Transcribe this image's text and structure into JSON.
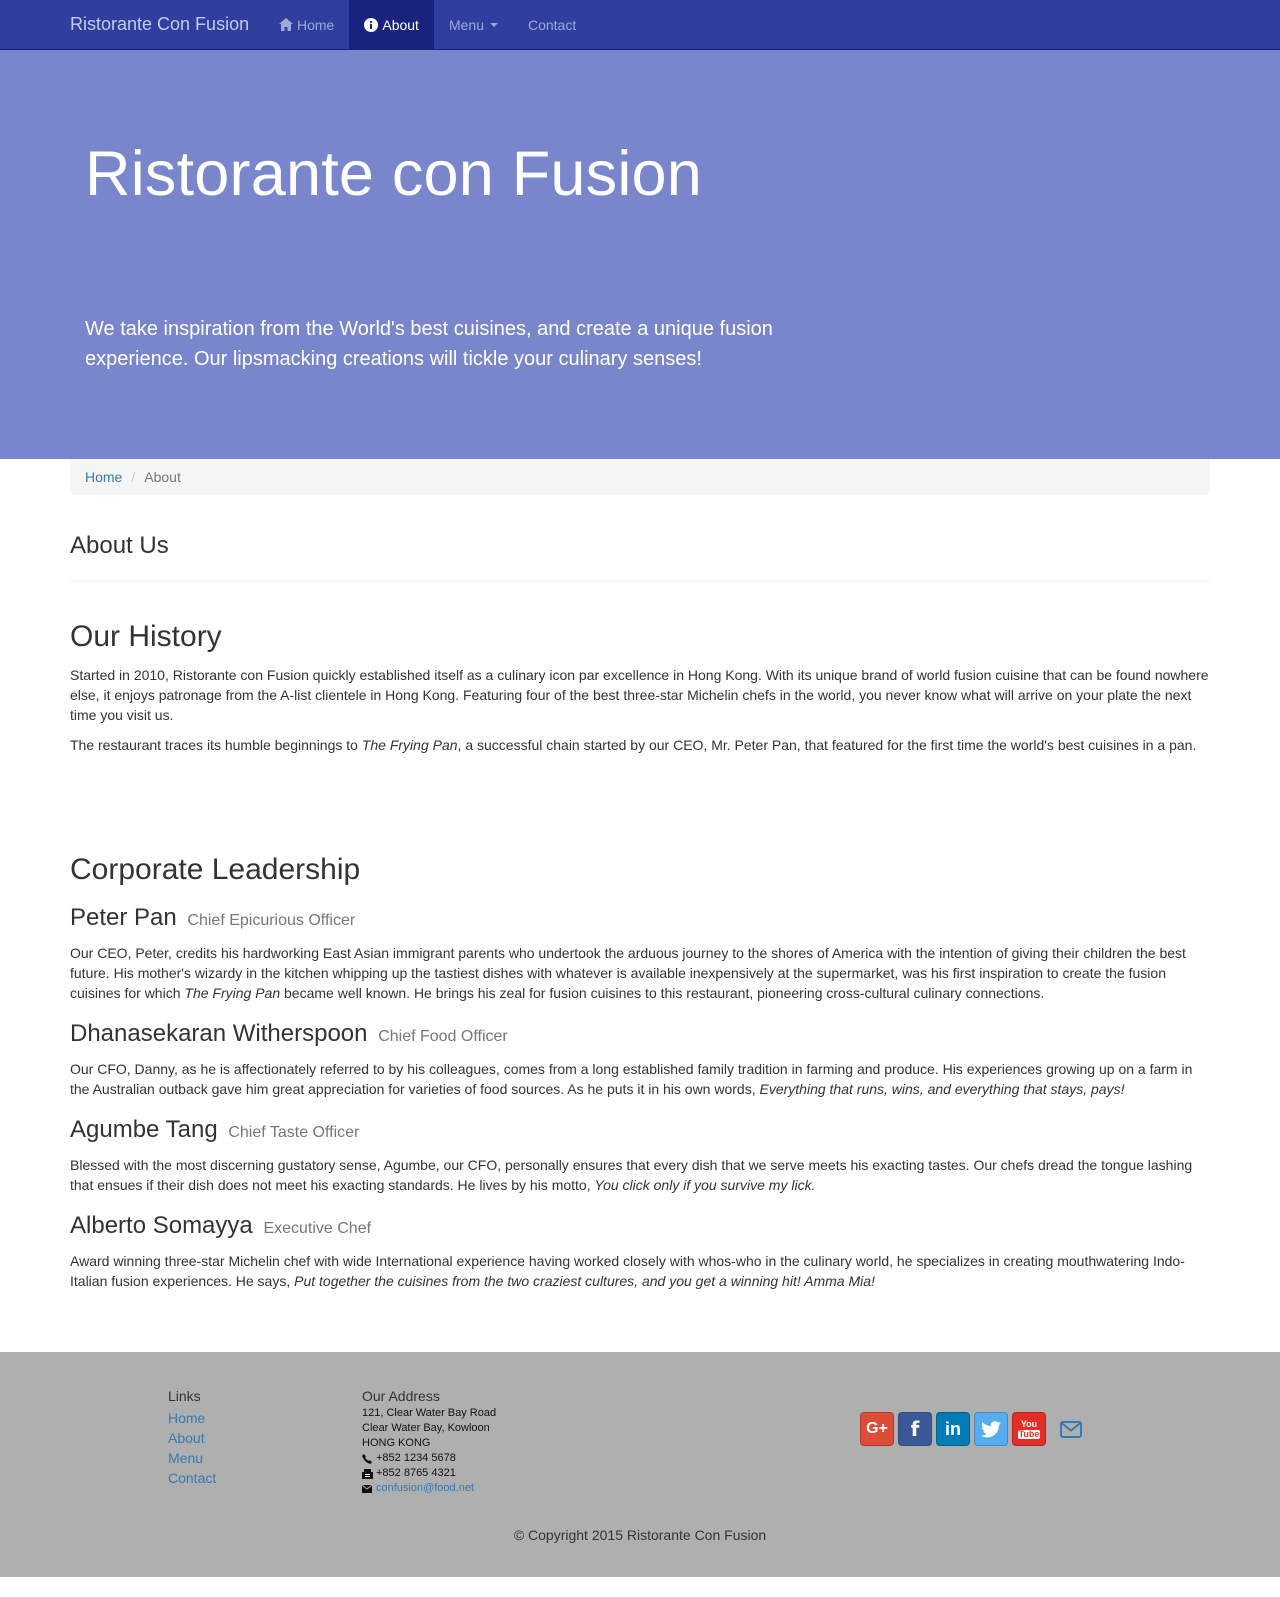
{
  "navbar": {
    "brand": "Ristorante Con Fusion",
    "items": [
      {
        "label": "Home"
      },
      {
        "label": "About"
      },
      {
        "label": "Menu"
      },
      {
        "label": "Contact"
      }
    ]
  },
  "jumbotron": {
    "title": "Ristorante con Fusion",
    "text": "We take inspiration from the World's best cuisines, and create a unique fusion experience. Our lipsmacking creations will tickle your culinary senses!"
  },
  "breadcrumb": {
    "home": "Home",
    "active": "About"
  },
  "page_header": "About Us",
  "history": {
    "title": "Our History",
    "p1": "Started in 2010, Ristorante con Fusion quickly established itself as a culinary icon par excellence in Hong Kong. With its unique brand of world fusion cuisine that can be found nowhere else, it enjoys patronage from the A-list clientele in Hong Kong. Featuring four of the best three-star Michelin chefs in the world, you never know what will arrive on your plate the next time you visit us.",
    "p2_pre": "The restaurant traces its humble beginnings to ",
    "p2_em": "The Frying Pan",
    "p2_post": ", a successful chain started by our CEO, Mr. Peter Pan, that featured for the first time the world's best cuisines in a pan."
  },
  "leadership": {
    "title": "Corporate Leadership",
    "leaders": [
      {
        "name": "Peter Pan",
        "role": "Chief Epicurious Officer",
        "pre": "Our CEO, Peter, credits his hardworking East Asian immigrant parents who undertook the arduous journey to the shores of America with the intention of giving their children the best future. His mother's wizardy in the kitchen whipping up the tastiest dishes with whatever is available inexpensively at the supermarket, was his first inspiration to create the fusion cuisines for which ",
        "em": "The Frying Pan",
        "post": " became well known. He brings his zeal for fusion cuisines to this restaurant, pioneering cross-cultural culinary connections."
      },
      {
        "name": "Dhanasekaran Witherspoon",
        "role": "Chief Food Officer",
        "pre": "Our CFO, Danny, as he is affectionately referred to by his colleagues, comes from a long established family tradition in farming and produce. His experiences growing up on a farm in the Australian outback gave him great appreciation for varieties of food sources. As he puts it in his own words, ",
        "em": "Everything that runs, wins, and everything that stays, pays!",
        "post": ""
      },
      {
        "name": "Agumbe Tang",
        "role": "Chief Taste Officer",
        "pre": "Blessed with the most discerning gustatory sense, Agumbe, our CFO, personally ensures that every dish that we serve meets his exacting tastes. Our chefs dread the tongue lashing that ensues if their dish does not meet his exacting standards. He lives by his motto, ",
        "em": "You click only if you survive my lick.",
        "post": ""
      },
      {
        "name": "Alberto Somayya",
        "role": "Executive Chef",
        "pre": "Award winning three-star Michelin chef with wide International experience having worked closely with whos-who in the culinary world, he specializes in creating mouthwatering Indo-Italian fusion experiences. He says, ",
        "em": "Put together the cuisines from the two craziest cultures, and you get a winning hit! Amma Mia!",
        "post": ""
      }
    ]
  },
  "footer": {
    "links_title": "Links",
    "links": [
      "Home",
      "About",
      "Menu",
      "Contact"
    ],
    "address_title": "Our Address",
    "address_lines": [
      "121, Clear Water Bay Road",
      "Clear Water Bay, Kowloon",
      "HONG KONG"
    ],
    "phone": "+852 1234 5678",
    "fax": "+852 8765 4321",
    "email": "confusion@food.net",
    "social": [
      {
        "icon": "google-plus-icon",
        "label": "G+",
        "color": "#dd4b39"
      },
      {
        "icon": "facebook-icon",
        "label": "f",
        "color": "#3b5998"
      },
      {
        "icon": "linkedin-icon",
        "label": "in",
        "color": "#007bb6"
      },
      {
        "icon": "twitter-icon",
        "label": "",
        "color": "#55acee"
      },
      {
        "icon": "youtube-icon",
        "label": "You",
        "color": "#e52d27"
      }
    ],
    "copyright": "© Copyright 2015 Ristorante Con Fusion"
  }
}
